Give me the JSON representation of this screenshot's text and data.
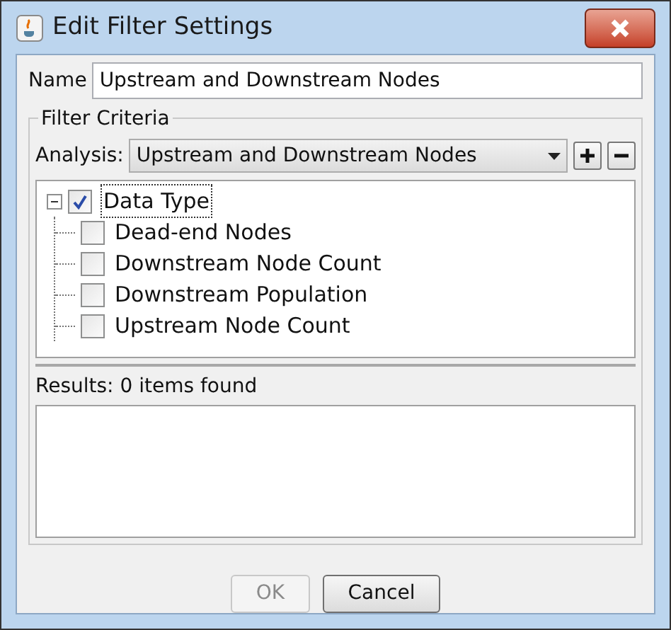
{
  "window": {
    "title": "Edit Filter Settings"
  },
  "name_field": {
    "label": "Name",
    "value": "Upstream and Downstream Nodes"
  },
  "filter_criteria": {
    "title": "Filter Criteria",
    "analysis": {
      "label": "Analysis:",
      "value": "Upstream and Downstream Nodes"
    },
    "tree": [
      {
        "label": "Data Type",
        "checked": true,
        "expanded": true,
        "children": [
          {
            "label": "Dead-end Nodes",
            "checked": false
          },
          {
            "label": "Downstream Node Count",
            "checked": false
          },
          {
            "label": "Downstream Population",
            "checked": false
          },
          {
            "label": "Upstream Node Count",
            "checked": false
          }
        ]
      }
    ]
  },
  "results": {
    "label": "Results: 0 items found"
  },
  "buttons": [
    {
      "label": "OK",
      "disabled": true
    },
    {
      "label": "Cancel",
      "disabled": false
    }
  ]
}
